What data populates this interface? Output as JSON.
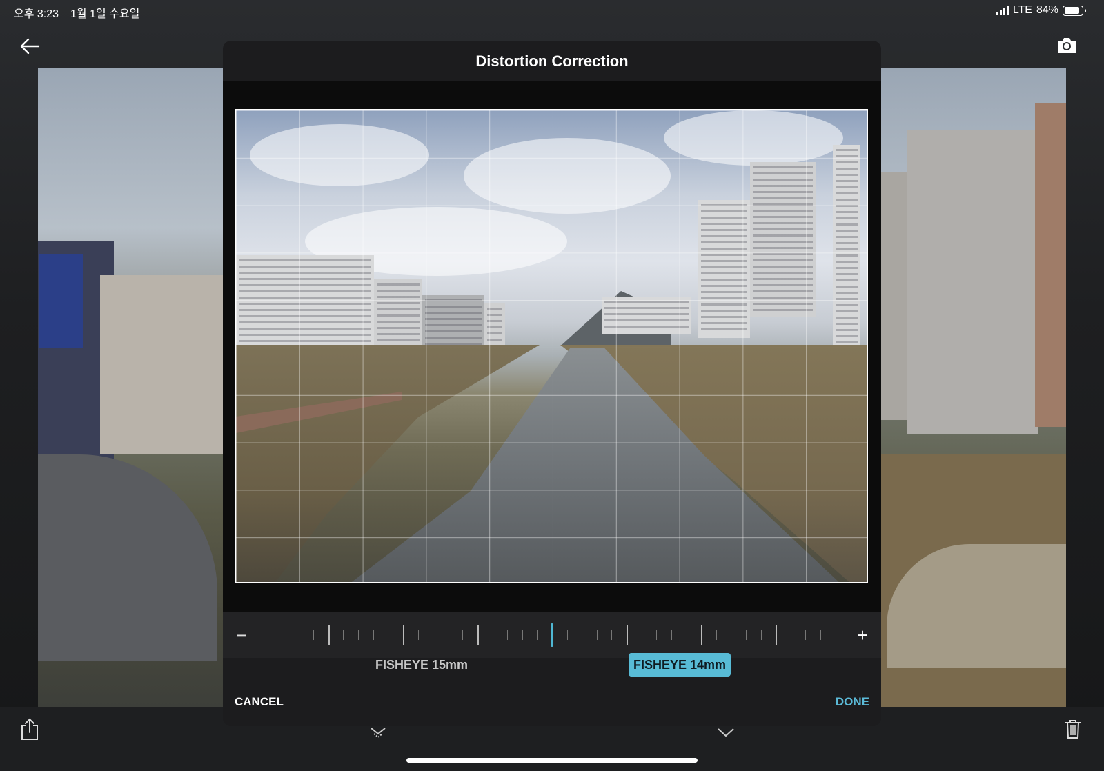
{
  "status_bar": {
    "time": "오후 3:23",
    "date": "1월 1일 수요일",
    "network": "LTE",
    "battery": "84%",
    "battery_level": 0.84
  },
  "nav": {
    "back_icon": "arrow-left-icon",
    "camera_icon": "camera-icon"
  },
  "modal": {
    "title": "Distortion Correction",
    "slider": {
      "minus": "−",
      "plus": "+",
      "value": 0.5
    },
    "options": [
      {
        "label": "FISHEYE 15mm",
        "selected": false
      },
      {
        "label": "FISHEYE 14mm",
        "selected": true
      }
    ],
    "cancel_label": "CANCEL",
    "done_label": "DONE"
  },
  "toolbar": {
    "share_icon": "share-icon",
    "trash_icon": "trash-icon"
  },
  "colors": {
    "accent": "#58bbd6",
    "modal_bg": "#1c1c1e",
    "toolbar_bg": "#1e1f21"
  }
}
